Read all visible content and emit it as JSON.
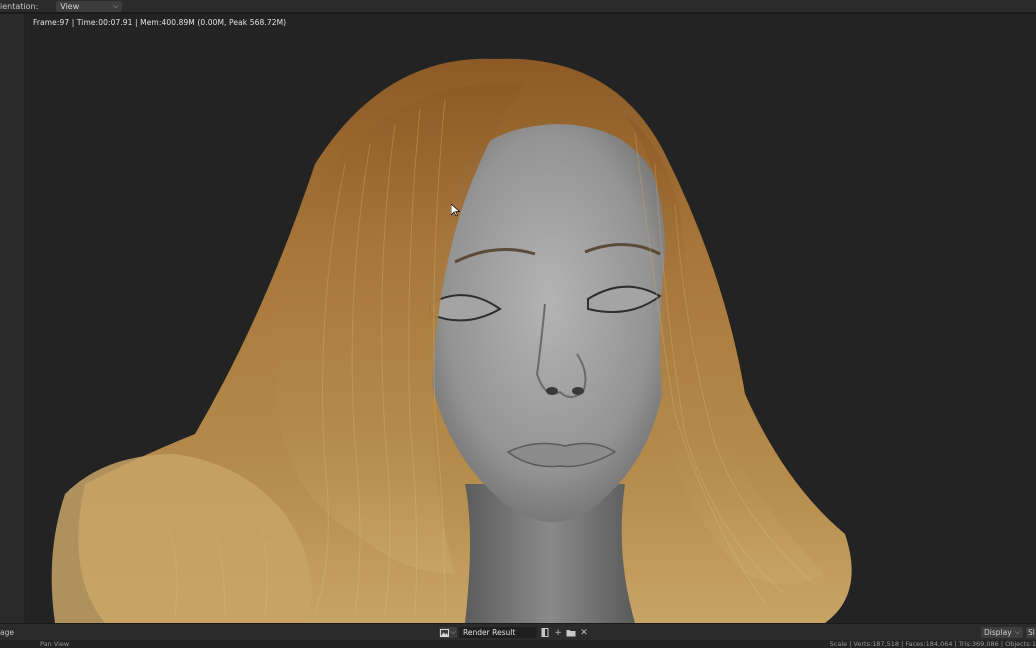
{
  "header": {
    "orientation_label": "ientation:",
    "orientation_value": "View"
  },
  "viewport": {
    "render_info": "Frame:97 | Time:00:07.91 | Mem:400.89M (0.00M, Peak 568.72M)"
  },
  "bottom_bar": {
    "image_menu_label": "age",
    "image_name": "Render Result",
    "display_label": "Display",
    "extra_label": "Sl"
  },
  "status_bar": {
    "left_text": "Pan View",
    "right_text": "Scale | Verts:187,518 | Faces:184,064 | Tris:369,086 | Objects:1"
  },
  "icons": [
    "chevron-down-icon",
    "image-type-icon",
    "pin-icon",
    "new-image-icon",
    "open-image-icon",
    "close-icon",
    "mouse-cursor-icon"
  ],
  "colors": {
    "ui_panel": "#2b2b2b",
    "viewport_bg": "#232323",
    "hair": "#a8783a",
    "skin": "#9a9a9a"
  }
}
